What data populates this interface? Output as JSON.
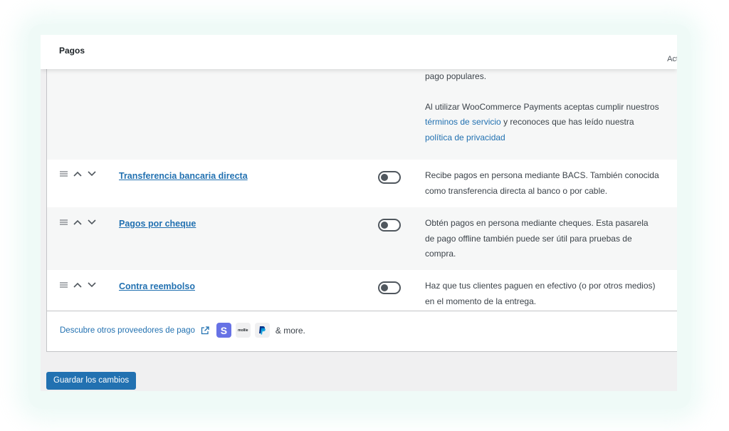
{
  "header": {
    "title": "Pagos",
    "right_text": "Act"
  },
  "woocommerce_payments": {
    "desc_tail": "pago populares.",
    "terms_intro": "Al utilizar WooCommerce Payments aceptas cumplir nuestros",
    "terms_link": "términos de servicio",
    "terms_mid": "y reconoces que has leído nuestra",
    "privacy_link": "política de privacidad"
  },
  "gateways": [
    {
      "name": "Transferencia bancaria directa",
      "enabled": false,
      "description": "Recibe pagos en persona mediante BACS. También conocida como transferencia directa al banco o por cable."
    },
    {
      "name": "Pagos por cheque",
      "enabled": false,
      "description": "Obtén pagos en persona mediante cheques. Esta pasarela de pago offline también puede ser útil para pruebas de compra."
    },
    {
      "name": "Contra reembolso",
      "enabled": false,
      "description": "Haz que tus clientes paguen en efectivo (o por otros medios) en el momento de la entrega."
    }
  ],
  "footer": {
    "discover_link": "Descubre otros proveedores de pago",
    "stripe_letter": "S",
    "mollie_label": "mollie",
    "more_text": "& more."
  },
  "actions": {
    "save_label": "Guardar los cambios"
  },
  "colors": {
    "link": "#2271b1",
    "button": "#2271b1",
    "toggle_off": "#50575e",
    "stripe": "#6772e5",
    "paypal_dark": "#003087",
    "paypal_light": "#009cde"
  },
  "icons": {
    "drag": "drag-handle-icon",
    "up": "chevron-up-icon",
    "down": "chevron-down-icon",
    "external": "external-link-icon"
  }
}
